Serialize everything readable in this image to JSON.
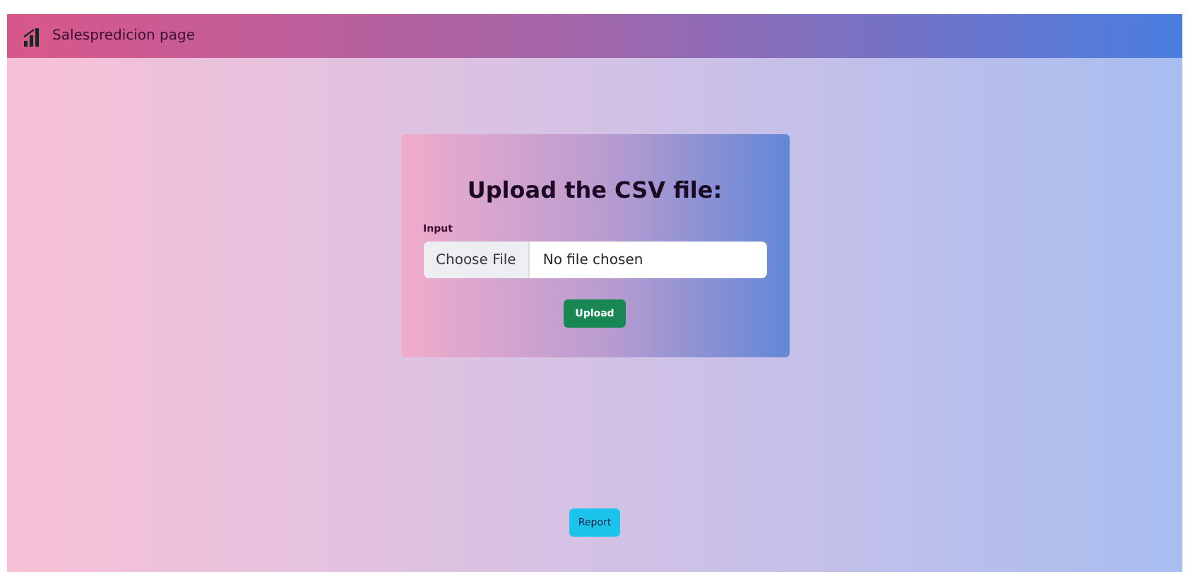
{
  "navbar": {
    "title": "Salespredicion page"
  },
  "upload_card": {
    "heading": "Upload the CSV file:",
    "label": "Input",
    "file_input": {
      "button": "Choose File",
      "value": "No file chosen"
    },
    "submit": "Upload"
  },
  "report_button": "Report"
}
